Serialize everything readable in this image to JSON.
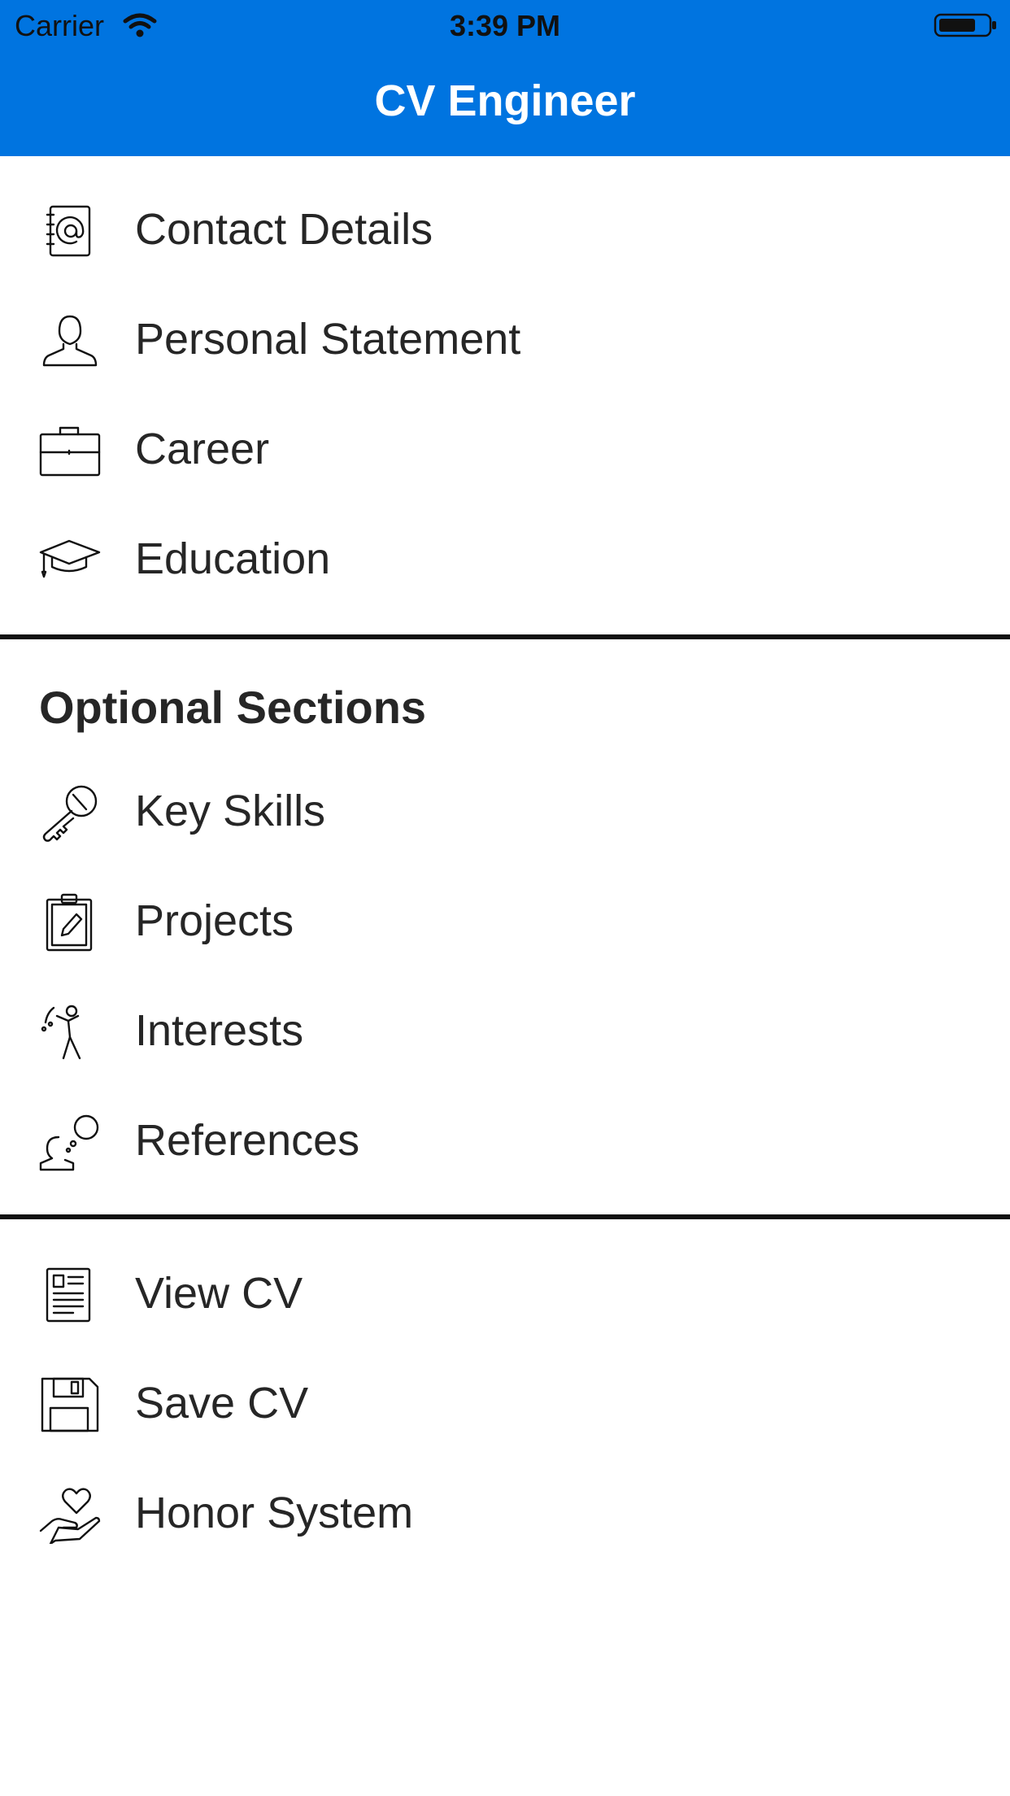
{
  "status_bar": {
    "carrier": "Carrier",
    "time": "3:39 PM",
    "wifi_icon": "wifi-icon",
    "battery_icon": "battery-icon"
  },
  "header": {
    "title": "CV Engineer",
    "background_color": "#0074E0"
  },
  "main_sections": {
    "items": [
      {
        "label": "Contact Details",
        "icon": "address-book-icon"
      },
      {
        "label": "Personal Statement",
        "icon": "person-icon"
      },
      {
        "label": "Career",
        "icon": "briefcase-icon"
      },
      {
        "label": "Education",
        "icon": "graduation-cap-icon"
      }
    ]
  },
  "optional_sections": {
    "title": "Optional Sections",
    "items": [
      {
        "label": "Key Skills",
        "icon": "key-icon"
      },
      {
        "label": "Projects",
        "icon": "clipboard-icon"
      },
      {
        "label": "Interests",
        "icon": "golfer-icon"
      },
      {
        "label": "References",
        "icon": "speech-thought-icon"
      }
    ]
  },
  "actions": {
    "items": [
      {
        "label": "View CV",
        "icon": "document-icon"
      },
      {
        "label": "Save CV",
        "icon": "floppy-disk-icon"
      },
      {
        "label": "Honor System",
        "icon": "hand-heart-icon"
      }
    ]
  }
}
